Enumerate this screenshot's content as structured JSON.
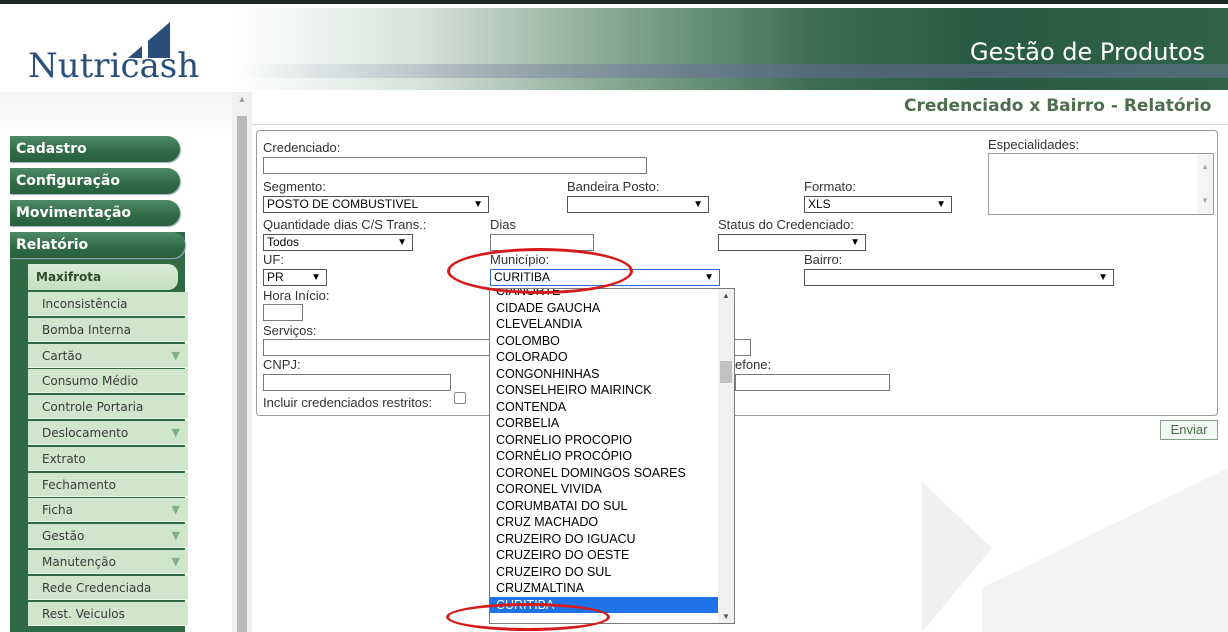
{
  "header": {
    "logo_text": "Nutricash",
    "banner_title": "Gestão de Produtos"
  },
  "sidebar": {
    "main_menu": [
      "Cadastro",
      "Configuração",
      "Movimentação",
      "Relatório"
    ],
    "submenu_title": "Maxifrota",
    "items": [
      {
        "label": "Inconsistência",
        "arrow": ""
      },
      {
        "label": "Bomba Interna",
        "arrow": ""
      },
      {
        "label": "Cartão",
        "arrow": "▼"
      },
      {
        "label": "Consumo Médio",
        "arrow": ""
      },
      {
        "label": "Controle Portaria",
        "arrow": ""
      },
      {
        "label": "Deslocamento",
        "arrow": "▼"
      },
      {
        "label": "Extrato",
        "arrow": ""
      },
      {
        "label": "Fechamento",
        "arrow": ""
      },
      {
        "label": "Ficha",
        "arrow": "▼"
      },
      {
        "label": "Gestão",
        "arrow": "▼"
      },
      {
        "label": "Manutenção",
        "arrow": "▼"
      },
      {
        "label": "Rede Credenciada",
        "arrow": ""
      },
      {
        "label": "Rest. Veiculos",
        "arrow": ""
      }
    ]
  },
  "page": {
    "title": "Credenciado x Bairro - Relatório"
  },
  "form": {
    "credenciado_label": "Credenciado:",
    "especialidades_label": "Especialidades:",
    "segmento_label": "Segmento:",
    "segmento_value": "POSTO DE COMBUSTIVEL",
    "bandeira_label": "Bandeira Posto:",
    "bandeira_value": "",
    "formato_label": "Formato:",
    "formato_value": "XLS",
    "qtd_dias_label": "Quantidade dias C/S Trans.:",
    "qtd_dias_value": "Todos",
    "dias_label": "Dias",
    "status_label": "Status do Credenciado:",
    "status_value": "",
    "uf_label": "UF:",
    "uf_value": "PR",
    "municipio_label": "Município:",
    "municipio_value": "CURITIBA",
    "bairro_label": "Bairro:",
    "bairro_value": "",
    "hora_inicio_label": "Hora Início:",
    "servicos_label": "Serviços:",
    "cnpj_label": "CNPJ:",
    "telefone_label_partial": "efone:",
    "incluir_label": "Incluir credenciados restritos:",
    "enviar_label": "Enviar"
  },
  "dropdown": {
    "options": [
      "CIANORTE",
      "CIDADE GAUCHA",
      "CLEVELANDIA",
      "COLOMBO",
      "COLORADO",
      "CONGONHINHAS",
      "CONSELHEIRO MAIRINCK",
      "CONTENDA",
      "CORBELIA",
      "CORNELIO PROCOPIO",
      "CORNÉLIO PROCÓPIO",
      "CORONEL DOMINGOS SOARES",
      "CORONEL VIVIDA",
      "CORUMBATAI DO SUL",
      "CRUZ MACHADO",
      "CRUZEIRO DO IGUACU",
      "CRUZEIRO DO OESTE",
      "CRUZEIRO DO SUL",
      "CRUZMALTINA",
      "CURITIBA"
    ],
    "selected": "CURITIBA"
  },
  "colors": {
    "menu_green": "#2f6a45",
    "sub_green": "#cfe6ca",
    "title_green": "#4d6f4d",
    "selection_blue": "#1e73e8",
    "annotation_red": "#d61a1a"
  }
}
